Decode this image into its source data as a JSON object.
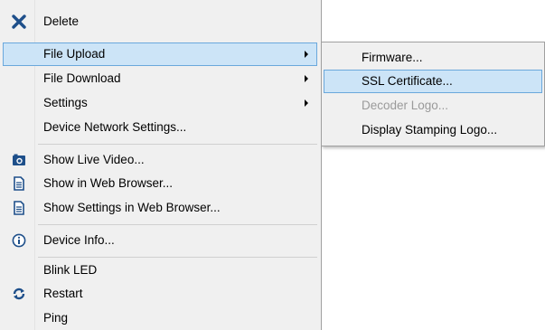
{
  "menu": {
    "items": [
      {
        "label": "Delete",
        "icon": "close-icon"
      },
      {
        "label": "File Upload",
        "submenu": true
      },
      {
        "label": "File Download",
        "submenu": true
      },
      {
        "label": "Settings",
        "submenu": true
      },
      {
        "label": "Device Network Settings..."
      },
      {
        "label": "Show Live Video...",
        "icon": "camera-icon"
      },
      {
        "label": "Show in Web Browser...",
        "icon": "document-icon"
      },
      {
        "label": "Show Settings in Web Browser...",
        "icon": "document-icon"
      },
      {
        "label": "Device Info...",
        "icon": "info-icon"
      },
      {
        "label": "Blink LED"
      },
      {
        "label": "Restart",
        "icon": "refresh-icon"
      },
      {
        "label": "Ping"
      }
    ]
  },
  "submenu": {
    "items": [
      {
        "label": "Firmware..."
      },
      {
        "label": "SSL Certificate..."
      },
      {
        "label": "Decoder Logo...",
        "disabled": true
      },
      {
        "label": "Display Stamping Logo..."
      }
    ]
  },
  "colors": {
    "menu_bg": "#f0f0f0",
    "highlight_bg": "#cce4f7",
    "highlight_border": "#6aa8dc",
    "disabled_text": "#9a9a9a",
    "icon_blue": "#1e4f8a"
  }
}
